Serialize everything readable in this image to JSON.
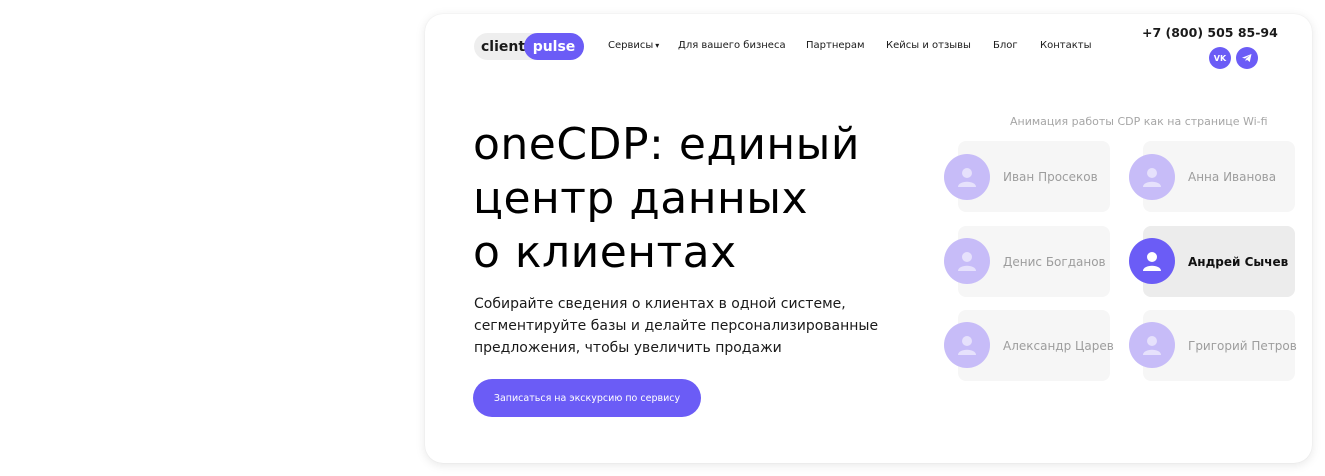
{
  "logo": {
    "left_text": "client",
    "right_text": "pulse"
  },
  "nav": {
    "services": "Сервисы",
    "business": "Для вашего бизнеса",
    "partners": "Партнерам",
    "cases": "Кейсы и отзывы",
    "blog": "Блог",
    "contacts": "Контакты"
  },
  "contact": {
    "phone": "+7 (800) 505 85-94",
    "social": [
      {
        "icon": "vk-icon"
      },
      {
        "icon": "telegram-icon"
      }
    ]
  },
  "hero": {
    "title_lines": [
      "oneCDP: единый",
      "центр данных",
      "о клиентах"
    ],
    "description_lines": [
      "Собирайте сведения о клиентах в одной системе,",
      "сегментируйте базы и делайте персонализированные",
      "предложения, чтобы увеличить продажи"
    ],
    "cta": "Записаться на экскурсию по сервису"
  },
  "animation": {
    "caption": "Анимация работы CDP как на странице Wi-fi",
    "users": [
      {
        "name": "Иван Просеков",
        "active": false
      },
      {
        "name": "Анна Иванова",
        "active": false
      },
      {
        "name": "Денис Богданов",
        "active": false
      },
      {
        "name": "Андрей Сычев",
        "active": true
      },
      {
        "name": "Александр Царев",
        "active": false
      },
      {
        "name": "Григорий Петров",
        "active": false
      }
    ]
  },
  "colors": {
    "accent": "#6b5cf6",
    "avatar_inactive": "#c7bcf8",
    "card_bg": "#f6f6f6",
    "card_bg_active": "#ececec"
  }
}
